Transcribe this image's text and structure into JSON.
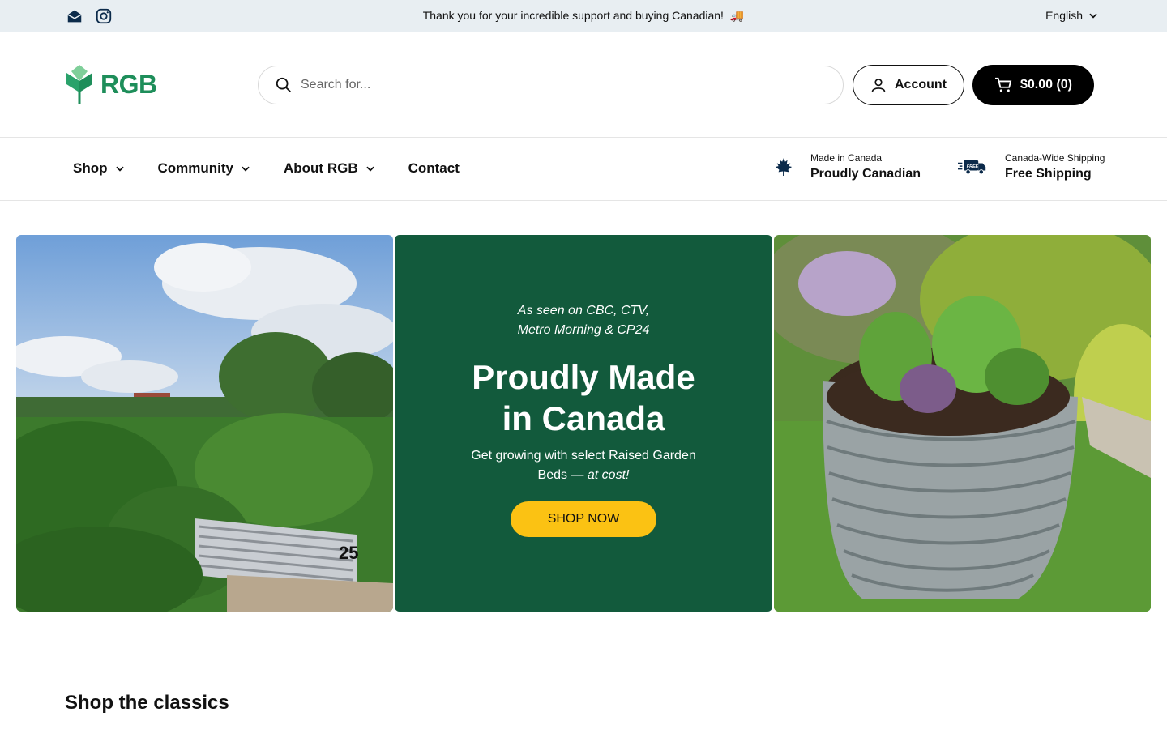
{
  "topbar": {
    "announcement": "Thank you for your incredible support and buying Canadian!",
    "announcement_emoji": "🚚",
    "language": "English",
    "social_icons": [
      "email-icon",
      "instagram-icon"
    ]
  },
  "header": {
    "logo_text": "RGB",
    "search_placeholder": "Search for...",
    "account_label": "Account",
    "cart_label": "$0.00 (0)"
  },
  "nav": {
    "items": [
      {
        "label": "Shop",
        "has_dropdown": true
      },
      {
        "label": "Community",
        "has_dropdown": true
      },
      {
        "label": "About RGB",
        "has_dropdown": true
      },
      {
        "label": "Contact",
        "has_dropdown": false
      }
    ],
    "features": [
      {
        "small": "Made in Canada",
        "big": "Proudly Canadian",
        "icon": "maple-leaf-icon"
      },
      {
        "small": "Canada-Wide Shipping",
        "big": "Free Shipping",
        "icon": "delivery-truck-icon"
      }
    ]
  },
  "hero": {
    "seen_line1": "As seen on CBC, CTV,",
    "seen_line2": "Metro Morning & CP24",
    "headline_line1": "Proudly Made",
    "headline_line2": "in Canada",
    "sub_text": "Get growing with select Raised Garden Beds —",
    "sub_emphasis": "at cost!",
    "cta": "SHOP NOW"
  },
  "sections": {
    "classics_title": "Shop the classics"
  },
  "colors": {
    "brand_green": "#1e8e5a",
    "hero_green": "#125a3c",
    "cta_yellow": "#fbc213",
    "topbar_bg": "#e8eef2"
  }
}
